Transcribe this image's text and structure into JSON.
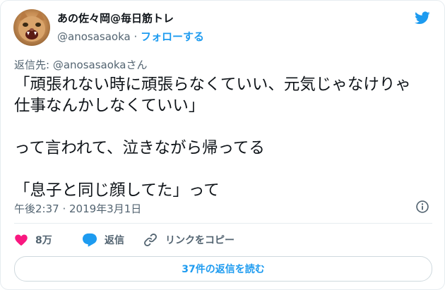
{
  "author": {
    "name": "あの佐々岡@毎日筋トレ",
    "handle": "@anosasaoka",
    "separator": " · ",
    "follow_label": "フォローする"
  },
  "reply_to": "返信先: @anosasaokaさん",
  "tweet": {
    "line1": "「頑張れない時に頑張らなくていい、元気じゃなけりゃ",
    "line2": "仕事なんかしなくていい」",
    "line3": "って言われて、泣きながら帰ってる",
    "line4": "「息子と同じ顔してた」って"
  },
  "timestamp": "午後2:37 · 2019年3月1日",
  "actions": {
    "like_count": "8万",
    "reply_label": "返信",
    "copy_link_label": "リンクをコピー"
  },
  "read_replies_label": "37件の返信を読む",
  "icons": {
    "logo": "twitter-bird-icon",
    "info": "info-icon",
    "like": "heart-icon",
    "reply": "reply-bubble-icon",
    "link": "link-icon"
  },
  "colors": {
    "accent": "#1d9bf0",
    "like": "#f91880",
    "secondary_text": "#536471",
    "primary_text": "#0f1419",
    "border": "#e6ecf0"
  }
}
